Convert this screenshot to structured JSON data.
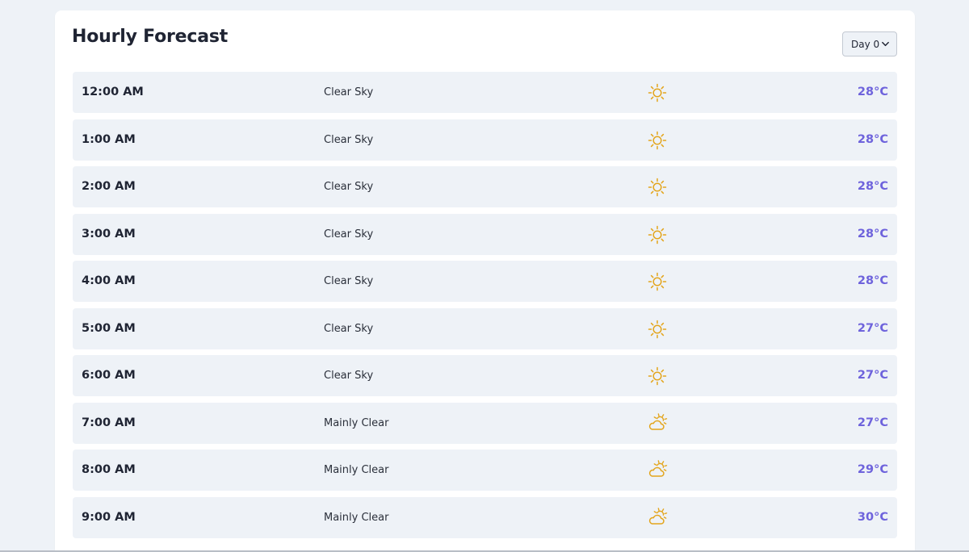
{
  "forecast": {
    "title": "Hourly Forecast",
    "day_select": {
      "selected": "Day 0"
    },
    "colors": {
      "temperature": "#6e63dc",
      "icon": "#e3a51c",
      "row_background": "#eef2f7"
    },
    "rows": [
      {
        "time": "12:00 AM",
        "condition": "Clear Sky",
        "icon": "sun-icon",
        "temp": "28°C"
      },
      {
        "time": "1:00 AM",
        "condition": "Clear Sky",
        "icon": "sun-icon",
        "temp": "28°C"
      },
      {
        "time": "2:00 AM",
        "condition": "Clear Sky",
        "icon": "sun-icon",
        "temp": "28°C"
      },
      {
        "time": "3:00 AM",
        "condition": "Clear Sky",
        "icon": "sun-icon",
        "temp": "28°C"
      },
      {
        "time": "4:00 AM",
        "condition": "Clear Sky",
        "icon": "sun-icon",
        "temp": "28°C"
      },
      {
        "time": "5:00 AM",
        "condition": "Clear Sky",
        "icon": "sun-icon",
        "temp": "27°C"
      },
      {
        "time": "6:00 AM",
        "condition": "Clear Sky",
        "icon": "sun-icon",
        "temp": "27°C"
      },
      {
        "time": "7:00 AM",
        "condition": "Mainly Clear",
        "icon": "partly-cloudy-icon",
        "temp": "27°C"
      },
      {
        "time": "8:00 AM",
        "condition": "Mainly Clear",
        "icon": "partly-cloudy-icon",
        "temp": "29°C"
      },
      {
        "time": "9:00 AM",
        "condition": "Mainly Clear",
        "icon": "partly-cloudy-icon",
        "temp": "30°C"
      }
    ]
  }
}
